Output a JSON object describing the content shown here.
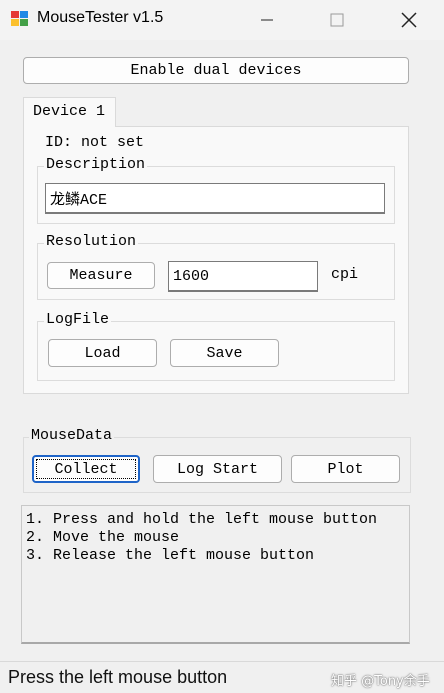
{
  "window": {
    "title": "MouseTester v1.5",
    "icons": {
      "app": "mouse-tester-app-icon",
      "minimize": "minimize-icon",
      "maximize": "maximize-icon",
      "close": "close-icon"
    }
  },
  "toolbar": {
    "enable_dual": "Enable dual devices"
  },
  "tabs": [
    {
      "label": "Device 1",
      "selected": true
    }
  ],
  "device": {
    "id_label": "ID: not set",
    "description_group": "Description",
    "description_value": "龙鳞ACE",
    "resolution_group": "Resolution",
    "measure_button": "Measure",
    "resolution_value": "1600",
    "resolution_unit": "cpi",
    "logfile_group": "LogFile",
    "load_button": "Load",
    "save_button": "Save"
  },
  "mousedata": {
    "group": "MouseData",
    "collect_button": "Collect",
    "logstart_button": "Log Start",
    "plot_button": "Plot"
  },
  "instructions": [
    "1. Press and hold the left mouse button",
    "2. Move the mouse",
    "3. Release the left mouse button"
  ],
  "status": {
    "text": "Press the left mouse button"
  },
  "watermark": "知乎 @Tony余手"
}
